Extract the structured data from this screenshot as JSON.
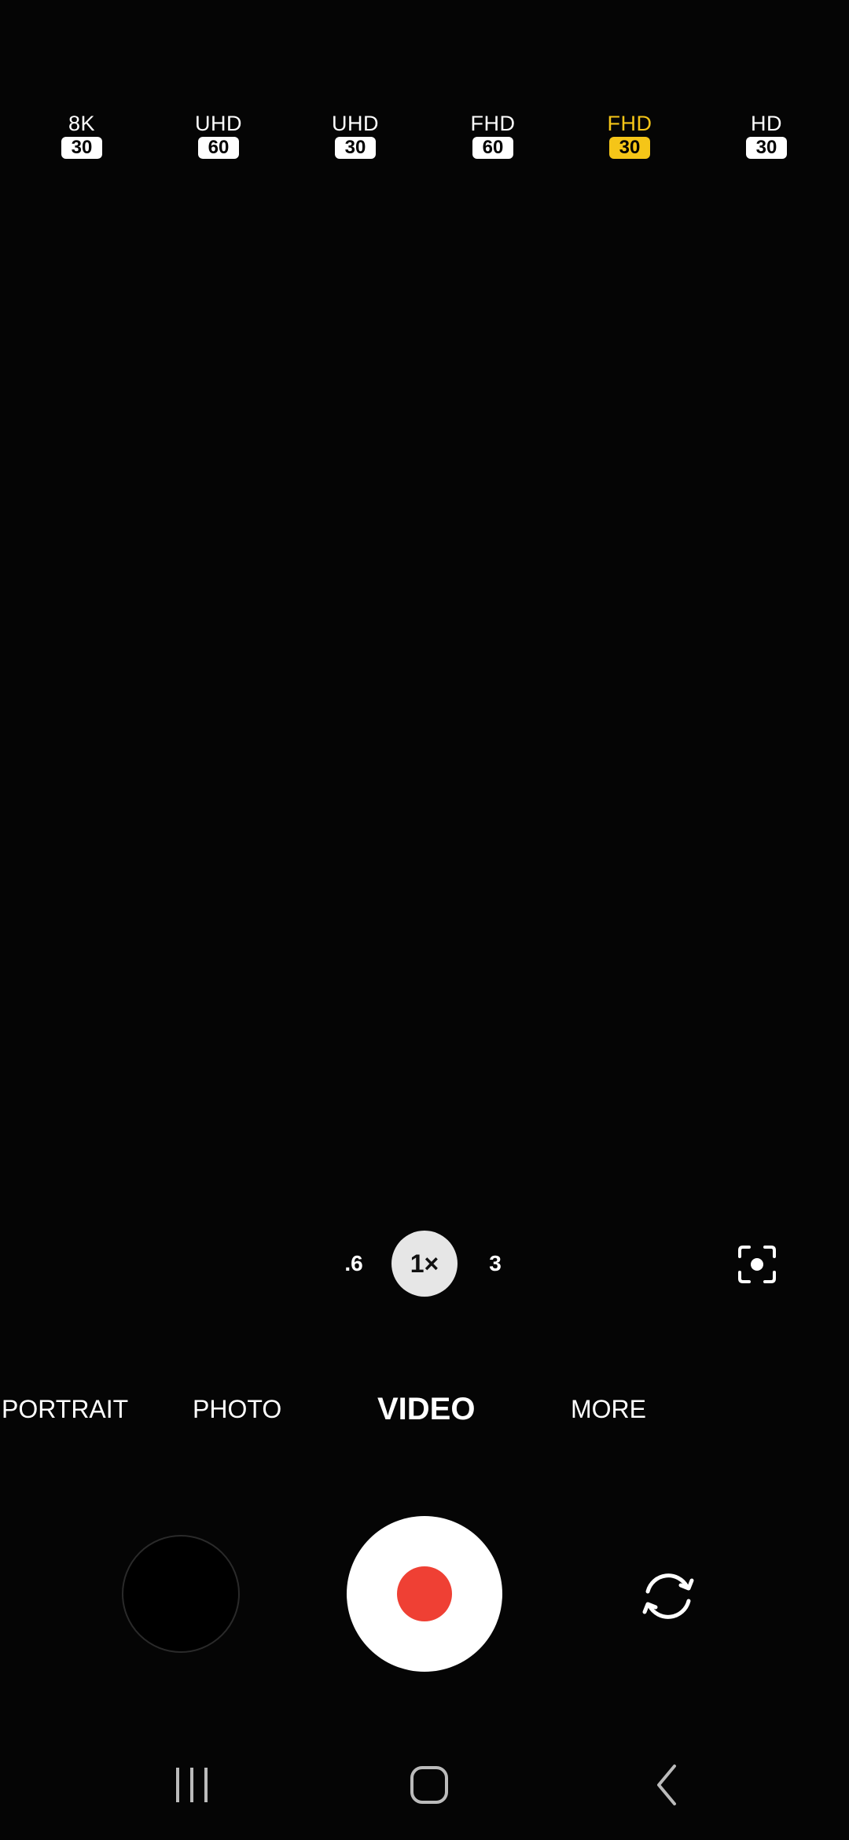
{
  "resolutions": [
    {
      "name": "8K",
      "fps": "30",
      "selected": false
    },
    {
      "name": "UHD",
      "fps": "60",
      "selected": false
    },
    {
      "name": "UHD",
      "fps": "30",
      "selected": false
    },
    {
      "name": "FHD",
      "fps": "60",
      "selected": false
    },
    {
      "name": "FHD",
      "fps": "30",
      "selected": true
    },
    {
      "name": "HD",
      "fps": "30",
      "selected": false
    }
  ],
  "zoom": {
    "options": [
      ".6",
      "1×",
      "3"
    ],
    "selected": "1×"
  },
  "modes": {
    "portrait": "PORTRAIT",
    "photo": "PHOTO",
    "video": "VIDEO",
    "more": "MORE",
    "selected": "VIDEO"
  },
  "icons": {
    "focus_lock": "focus-lock-icon",
    "switch_camera": "switch-camera-icon",
    "record": "record-icon",
    "nav_recents": "recents-icon",
    "nav_home": "home-icon",
    "nav_back": "back-icon"
  },
  "colors": {
    "selected_accent": "#f5c518",
    "record": "#ef4034",
    "background": "#000000"
  }
}
